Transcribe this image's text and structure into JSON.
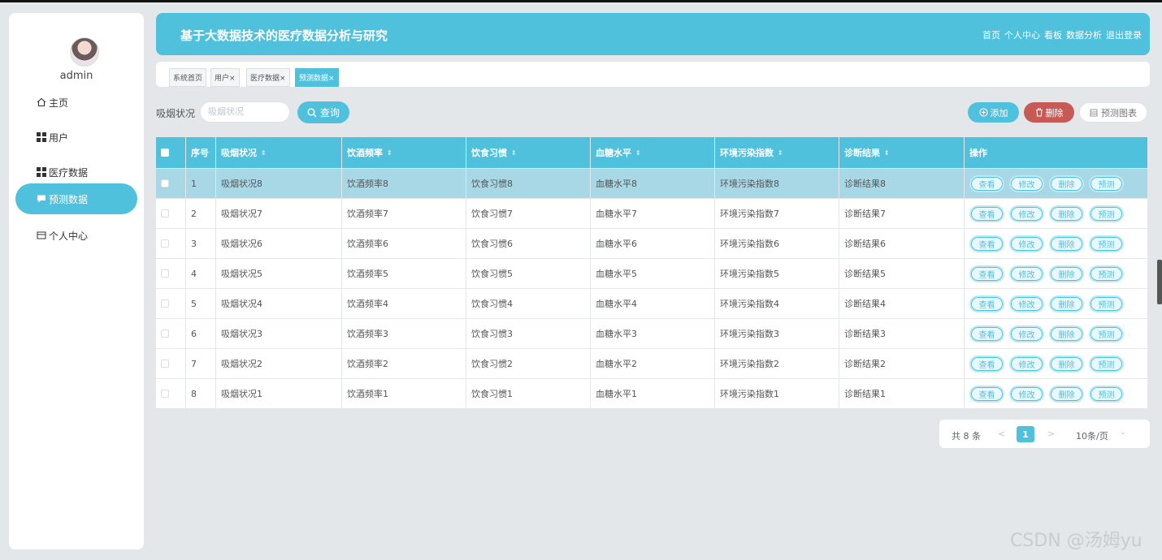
{
  "user": {
    "name": "admin"
  },
  "sidebar": {
    "items": [
      {
        "label": "主页",
        "icon": "home-icon"
      },
      {
        "label": "用户",
        "icon": "grid-icon"
      },
      {
        "label": "医疗数据",
        "icon": "grid-icon"
      },
      {
        "label": "预测数据",
        "icon": "chat-icon",
        "active": true
      },
      {
        "label": "个人中心",
        "icon": "card-icon"
      }
    ]
  },
  "header": {
    "title": "基于大数据技术的医疗数据分析与研究",
    "nav": [
      "首页",
      "个人中心",
      "看板",
      "数据分析",
      "退出登录"
    ]
  },
  "tabs": [
    {
      "label": "系统首页"
    },
    {
      "label": "用户×"
    },
    {
      "label": "医疗数据×"
    },
    {
      "label": "预测数据×",
      "active": true
    }
  ],
  "search": {
    "label": "吸烟状况",
    "placeholder": "吸烟状况",
    "query_label": "查询"
  },
  "toolbar": {
    "add_label": "添加",
    "delete_label": "删除",
    "chart_label": "预测图表"
  },
  "table": {
    "columns": [
      "序号",
      "吸烟状况",
      "饮酒频率",
      "饮食习惯",
      "血糖水平",
      "环境污染指数",
      "诊断结果",
      "操作"
    ],
    "rows": [
      {
        "idx": "1",
        "smoke": "吸烟状况8",
        "drink": "饮酒频率8",
        "diet": "饮食习惯8",
        "sugar": "血糖水平8",
        "env": "环境污染指数8",
        "result": "诊断结果8"
      },
      {
        "idx": "2",
        "smoke": "吸烟状况7",
        "drink": "饮酒频率7",
        "diet": "饮食习惯7",
        "sugar": "血糖水平7",
        "env": "环境污染指数7",
        "result": "诊断结果7"
      },
      {
        "idx": "3",
        "smoke": "吸烟状况6",
        "drink": "饮酒频率6",
        "diet": "饮食习惯6",
        "sugar": "血糖水平6",
        "env": "环境污染指数6",
        "result": "诊断结果6"
      },
      {
        "idx": "4",
        "smoke": "吸烟状况5",
        "drink": "饮酒频率5",
        "diet": "饮食习惯5",
        "sugar": "血糖水平5",
        "env": "环境污染指数5",
        "result": "诊断结果5"
      },
      {
        "idx": "5",
        "smoke": "吸烟状况4",
        "drink": "饮酒频率4",
        "diet": "饮食习惯4",
        "sugar": "血糖水平4",
        "env": "环境污染指数4",
        "result": "诊断结果4"
      },
      {
        "idx": "6",
        "smoke": "吸烟状况3",
        "drink": "饮酒频率3",
        "diet": "饮食习惯3",
        "sugar": "血糖水平3",
        "env": "环境污染指数3",
        "result": "诊断结果3"
      },
      {
        "idx": "7",
        "smoke": "吸烟状况2",
        "drink": "饮酒频率2",
        "diet": "饮食习惯2",
        "sugar": "血糖水平2",
        "env": "环境污染指数2",
        "result": "诊断结果2"
      },
      {
        "idx": "8",
        "smoke": "吸烟状况1",
        "drink": "饮酒频率1",
        "diet": "饮食习惯1",
        "sugar": "血糖水平1",
        "env": "环境污染指数1",
        "result": "诊断结果1"
      }
    ],
    "actions": [
      "查看",
      "修改",
      "删除",
      "预测"
    ]
  },
  "pagination": {
    "total": "共 8 条",
    "prev": "<",
    "current": "1",
    "next": ">",
    "page_size": "10条/页"
  },
  "watermark": "CSDN @汤姆yu",
  "colors": {
    "accent": "#4fc1dc",
    "danger": "#c85a56",
    "highlight_row": "#a8d8e6"
  }
}
